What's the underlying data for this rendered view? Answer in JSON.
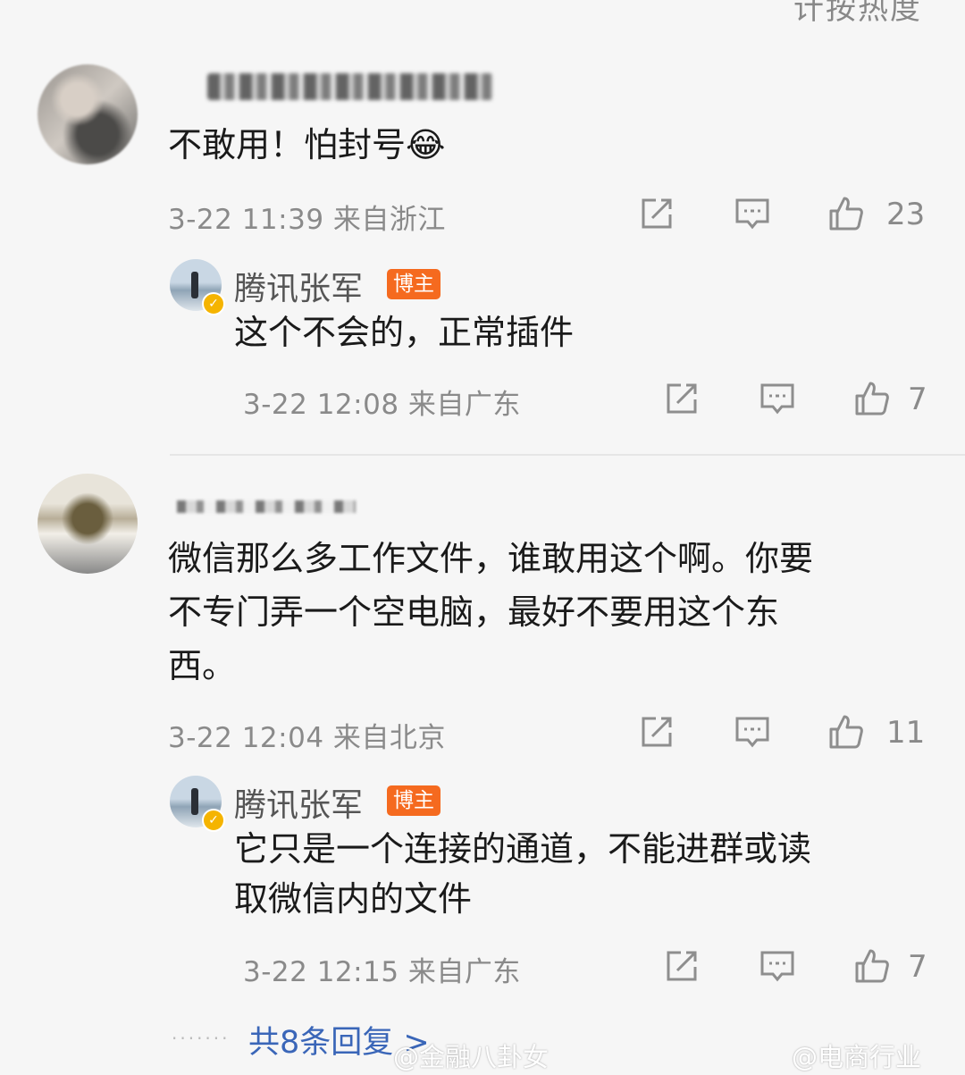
{
  "header": {
    "sort_label": "计按热度"
  },
  "comments": [
    {
      "text": "不敢用！怕封号😂",
      "meta": "3-22 11:39 来自浙江",
      "likes": "23",
      "reply": {
        "author": "腾讯张军",
        "badge": "博主",
        "text": "这个不会的，正常插件",
        "meta": "3-22 12:08 来自广东",
        "likes": "7"
      }
    },
    {
      "text_lines": [
        "微信那么多工作文件，谁敢用这个啊。你要",
        "不专门弄一个空电脑，最好不要用这个东",
        "西。"
      ],
      "meta": "3-22 12:04 来自北京",
      "likes": "11",
      "reply": {
        "author": "腾讯张军",
        "badge": "博主",
        "text_lines": [
          "它只是一个连接的通道，不能进群或读",
          "取微信内的文件"
        ],
        "meta": "3-22 12:15 来自广东",
        "likes": "7"
      }
    }
  ],
  "footer": {
    "more_replies": "共8条回复 >",
    "watermark_1": "@金融八卦女",
    "watermark_2": "@电商行业"
  },
  "icons": {
    "share": "share-icon",
    "comment": "comment-icon",
    "like": "like-icon"
  },
  "colors": {
    "background": "#f6f6f6",
    "badge": "#f56a1f",
    "link": "#3a66b8",
    "verify": "#f5b400"
  }
}
